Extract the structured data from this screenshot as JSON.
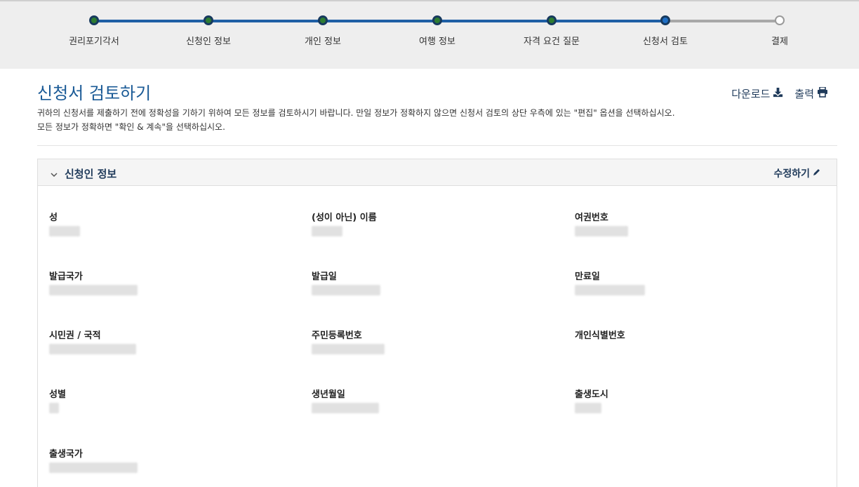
{
  "progress": {
    "steps": [
      {
        "label": "권리포기각서",
        "status": "complete"
      },
      {
        "label": "신청인 정보",
        "status": "complete"
      },
      {
        "label": "개인 정보",
        "status": "complete"
      },
      {
        "label": "여행 정보",
        "status": "complete"
      },
      {
        "label": "자격 요건 질문",
        "status": "complete"
      },
      {
        "label": "신청서 검토",
        "status": "current"
      },
      {
        "label": "결제",
        "status": "pending"
      }
    ]
  },
  "header": {
    "title": "신청서 검토하기",
    "intro_line1": "귀하의 신청서를 제출하기 전에 정확성을 기하기 위하여 모든 정보를 검토하시기 바랍니다. 만일 정보가 정확하지 않으면 신청서 검토의 상단 우측에 있는 \"편집\" 옵션을 선택하십시오.",
    "intro_line2": "모든 정보가 정확하면 \"확인 & 계속\"을 선택하십시오.",
    "download_label": "다운로드",
    "print_label": "출력",
    "download_icon": "download-icon",
    "print_icon": "printer-icon"
  },
  "panel": {
    "title": "신청인 정보",
    "edit_label": "수정하기",
    "fields": [
      {
        "label": "성"
      },
      {
        "label": "(성이 아닌) 이름"
      },
      {
        "label": "여권번호"
      },
      {
        "label": "발급국가"
      },
      {
        "label": "발급일"
      },
      {
        "label": "만료일"
      },
      {
        "label": "시민권 / 국적"
      },
      {
        "label": "주민등록번호"
      },
      {
        "label": "개인식별번호"
      },
      {
        "label": "성별"
      },
      {
        "label": "생년월일"
      },
      {
        "label": "출생도시"
      },
      {
        "label": "출생국가"
      }
    ]
  },
  "colors": {
    "accent": "#1a5a96",
    "complete": "#2e7d32",
    "track": "#1f5fa5",
    "pending_track": "#a8a8a8"
  }
}
